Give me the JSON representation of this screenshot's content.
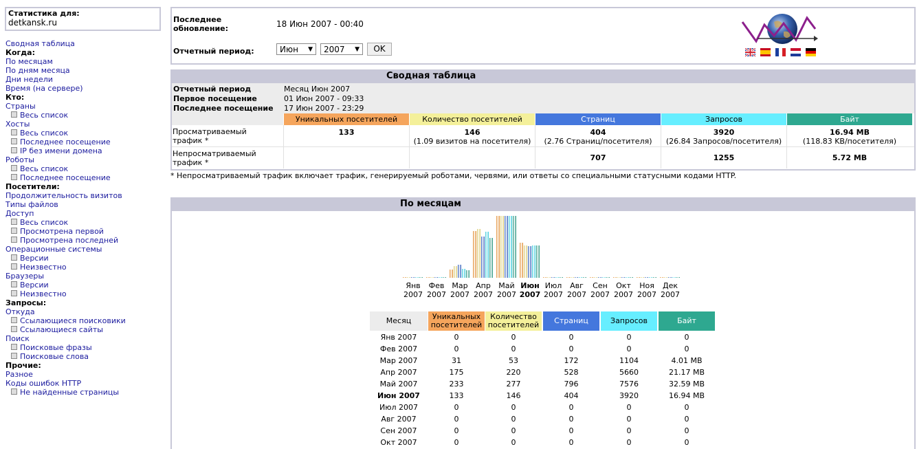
{
  "sidebar": {
    "stat_title": "Статистика для:",
    "site": "detkansk.ru",
    "menu": [
      {
        "type": "link",
        "label": "Сводная таблица"
      },
      {
        "type": "header",
        "label": "Когда:"
      },
      {
        "type": "link",
        "label": "По месяцам"
      },
      {
        "type": "link",
        "label": "По дням месяца"
      },
      {
        "type": "link",
        "label": "Дни недели"
      },
      {
        "type": "link",
        "label": "Время (на сервере)"
      },
      {
        "type": "header",
        "label": "Кто:"
      },
      {
        "type": "link",
        "label": "Страны"
      },
      {
        "type": "sub",
        "label": "Весь список"
      },
      {
        "type": "link",
        "label": "Хосты"
      },
      {
        "type": "sub",
        "label": "Весь список"
      },
      {
        "type": "sub",
        "label": "Последнее посещение"
      },
      {
        "type": "sub",
        "label": "IP без имени домена"
      },
      {
        "type": "link",
        "label": "Роботы"
      },
      {
        "type": "sub",
        "label": "Весь список"
      },
      {
        "type": "sub",
        "label": "Последнее посещение"
      },
      {
        "type": "header",
        "label": "Посетители:"
      },
      {
        "type": "link",
        "label": "Продолжительность визитов"
      },
      {
        "type": "link",
        "label": "Типы файлов"
      },
      {
        "type": "link",
        "label": "Доступ"
      },
      {
        "type": "sub",
        "label": "Весь список"
      },
      {
        "type": "sub",
        "label": "Просмотрена первой"
      },
      {
        "type": "sub",
        "label": "Просмотрена последней"
      },
      {
        "type": "link",
        "label": "Операционные системы"
      },
      {
        "type": "sub",
        "label": "Версии"
      },
      {
        "type": "sub",
        "label": "Неизвестно"
      },
      {
        "type": "link",
        "label": "Браузеры"
      },
      {
        "type": "sub",
        "label": "Версии"
      },
      {
        "type": "sub",
        "label": "Неизвестно"
      },
      {
        "type": "header",
        "label": "Запросы:"
      },
      {
        "type": "link",
        "label": "Откуда"
      },
      {
        "type": "sub",
        "label": "Ссылающиеся поисковики"
      },
      {
        "type": "sub",
        "label": "Ссылающиеся сайты"
      },
      {
        "type": "link",
        "label": "Поиск"
      },
      {
        "type": "sub",
        "label": "Поисковые фразы"
      },
      {
        "type": "sub",
        "label": "Поисковые слова"
      },
      {
        "type": "header",
        "label": "Прочие:"
      },
      {
        "type": "link",
        "label": "Разное"
      },
      {
        "type": "link",
        "label": "Коды ошибок HTTP"
      },
      {
        "type": "sub",
        "label": "Не найденные страницы"
      }
    ]
  },
  "header": {
    "last_update_label_1": "Последнее",
    "last_update_label_2": "обновление:",
    "last_update_value": "18 Июн 2007 - 00:40",
    "period_label": "Отчетный период:",
    "month_selected": "Июн",
    "year_selected": "2007",
    "ok_label": "OK"
  },
  "summary": {
    "title": "Сводная таблица",
    "period_label": "Отчетный период",
    "period_value": "Месяц Июн 2007",
    "first_visit_label": "Первое посещение",
    "first_visit_value": "01 Июн 2007 - 09:33",
    "last_visit_label": "Последнее посещение",
    "last_visit_value": "17 Июн 2007 - 23:29",
    "columns": [
      "Уникальных посетителей",
      "Количество посетителей",
      "Страниц",
      "Запросов",
      "Байт"
    ],
    "viewed_label_1": "Просматриваемый",
    "viewed_label_2": "трафик *",
    "viewed": [
      "133",
      "146",
      "404",
      "3920",
      "16.94 MB"
    ],
    "viewed_sub": [
      "",
      "(1.09 визитов на посетителя)",
      "(2.76 Страниц/посетителя)",
      "(26.84 Запросов/посетителя)",
      "(118.83 KB/посетителя)"
    ],
    "notviewed_label_1": "Непросматриваемый",
    "notviewed_label_2": "трафик *",
    "notviewed": [
      "",
      "",
      "707",
      "1255",
      "5.72 MB"
    ],
    "footnote": "* Непросматриваемый трафик включает трафик, генерируемый роботами, червями, или ответы со специальными статусными кодами HTTP."
  },
  "monthly": {
    "title": "По месяцам",
    "table_header_month": "Месяц",
    "columns": [
      "Уникальных посетителей",
      "Количество посетителей",
      "Страниц",
      "Запросов",
      "Байт"
    ],
    "rows": [
      {
        "month": "Янв 2007",
        "u": "0",
        "v": "0",
        "p": "0",
        "h": "0",
        "b": "0"
      },
      {
        "month": "Фев 2007",
        "u": "0",
        "v": "0",
        "p": "0",
        "h": "0",
        "b": "0"
      },
      {
        "month": "Мар 2007",
        "u": "31",
        "v": "53",
        "p": "172",
        "h": "1104",
        "b": "4.01 MB"
      },
      {
        "month": "Апр 2007",
        "u": "175",
        "v": "220",
        "p": "528",
        "h": "5660",
        "b": "21.17 MB"
      },
      {
        "month": "Май 2007",
        "u": "233",
        "v": "277",
        "p": "796",
        "h": "7576",
        "b": "32.59 MB"
      },
      {
        "month": "Июн 2007",
        "u": "133",
        "v": "146",
        "p": "404",
        "h": "3920",
        "b": "16.94 MB",
        "current": true
      },
      {
        "month": "Июл 2007",
        "u": "0",
        "v": "0",
        "p": "0",
        "h": "0",
        "b": "0"
      },
      {
        "month": "Авг 2007",
        "u": "0",
        "v": "0",
        "p": "0",
        "h": "0",
        "b": "0"
      },
      {
        "month": "Сен 2007",
        "u": "0",
        "v": "0",
        "p": "0",
        "h": "0",
        "b": "0"
      },
      {
        "month": "Окт 2007",
        "u": "0",
        "v": "0",
        "p": "0",
        "h": "0",
        "b": "0"
      }
    ],
    "chart_months": [
      "Янв",
      "Фев",
      "Мар",
      "Апр",
      "Май",
      "Июн",
      "Июл",
      "Авг",
      "Сен",
      "Окт",
      "Ноя",
      "Дек"
    ],
    "chart_year": "2007",
    "current_month_index": 5
  },
  "chart_data": {
    "type": "bar",
    "categories": [
      "Янв",
      "Фев",
      "Мар",
      "Апр",
      "Май",
      "Июн",
      "Июл",
      "Авг",
      "Сен",
      "Окт",
      "Ноя",
      "Дек"
    ],
    "series": [
      {
        "name": "Уникальных посетителей",
        "values": [
          0,
          0,
          31,
          175,
          233,
          133,
          0,
          0,
          0,
          0,
          0,
          0
        ]
      },
      {
        "name": "Количество посетителей",
        "values": [
          0,
          0,
          53,
          220,
          277,
          146,
          0,
          0,
          0,
          0,
          0,
          0
        ]
      },
      {
        "name": "Страниц",
        "values": [
          0,
          0,
          172,
          528,
          796,
          404,
          0,
          0,
          0,
          0,
          0,
          0
        ]
      },
      {
        "name": "Запросов",
        "values": [
          0,
          0,
          1104,
          5660,
          7576,
          3920,
          0,
          0,
          0,
          0,
          0,
          0
        ]
      },
      {
        "name": "Байт (MB)",
        "values": [
          0,
          0,
          4.01,
          21.17,
          32.59,
          16.94,
          0,
          0,
          0,
          0,
          0,
          0
        ]
      }
    ]
  },
  "colors": {
    "unique": "#f5a55c",
    "visits": "#f4f09a",
    "pages": "#4477dd",
    "hits": "#66eeff",
    "bytes": "#2ea890",
    "frame": "#c8c8d8"
  }
}
